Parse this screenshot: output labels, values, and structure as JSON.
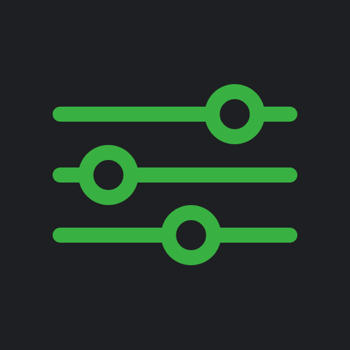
{
  "icon": {
    "name": "sliders-adjust-icon",
    "background_color": "#1e1f22",
    "accent_color": "#39b042",
    "knob_fill_color": "#1e1f22"
  },
  "sliders": [
    {
      "name": "slider-top",
      "level": 0.76
    },
    {
      "name": "slider-middle",
      "level": 0.21
    },
    {
      "name": "slider-bottom",
      "level": 0.57
    }
  ]
}
